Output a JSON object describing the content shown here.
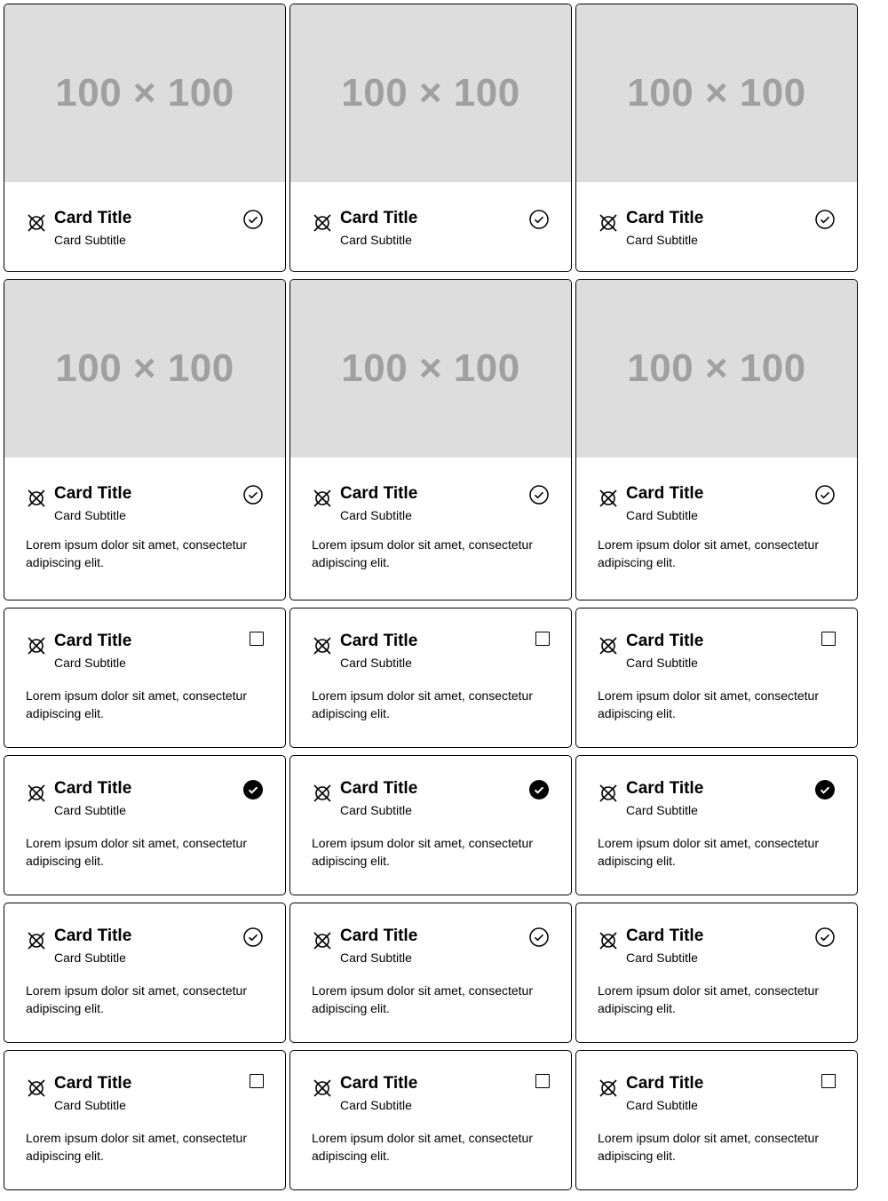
{
  "placeholder_text": "100 × 100",
  "card_title": "Card Title",
  "card_subtitle": "Card Subtitle",
  "card_body": "Lorem ipsum dolor sit amet, consectetur adipiscing elit.",
  "rows": [
    {
      "variant": "media-only",
      "selection": "check-outline"
    },
    {
      "variant": "media-text",
      "selection": "check-outline"
    },
    {
      "variant": "text-only",
      "selection": "checkbox-unchecked"
    },
    {
      "variant": "text-only",
      "selection": "check-filled"
    },
    {
      "variant": "text-only",
      "selection": "check-outline"
    },
    {
      "variant": "text-only",
      "selection": "checkbox-unchecked"
    }
  ],
  "icons": {
    "brand": "crossed-circle-icon",
    "select_outline": "check-circle-outline-icon",
    "select_filled": "check-circle-filled-icon",
    "checkbox": "checkbox-icon"
  },
  "colors": {
    "placeholder_bg": "#dddddd",
    "placeholder_text": "#a0a0a0",
    "border": "#000000"
  }
}
